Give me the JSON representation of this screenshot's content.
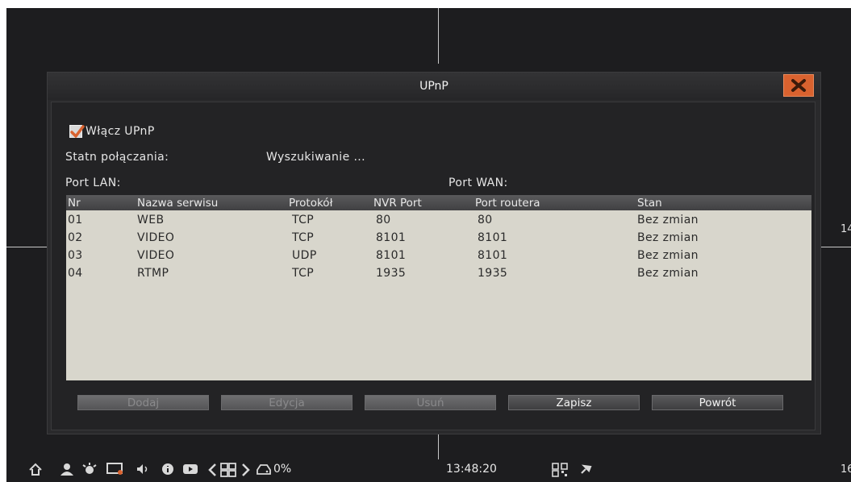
{
  "dialog": {
    "title": "UPnP",
    "close_icon": "close-x-icon"
  },
  "upnp": {
    "enable_label": "Włącz UPnP",
    "enabled": true,
    "status_label": "Statn połączania:",
    "status_value": "Wyszukiwanie ...",
    "port_lan_label": "Port LAN:",
    "port_wan_label": "Port WAN:"
  },
  "table": {
    "headers": [
      "Nr",
      "Nazwa serwisu",
      "Protokół",
      "NVR Port",
      "Port routera",
      "Stan"
    ],
    "rows": [
      [
        "01",
        "WEB",
        "TCP",
        "80",
        "80",
        "Bez zmian"
      ],
      [
        "02",
        "VIDEO",
        "TCP",
        "8101",
        "8101",
        "Bez zmian"
      ],
      [
        "03",
        "VIDEO",
        "UDP",
        "8101",
        "8101",
        "Bez zmian"
      ],
      [
        "04",
        "RTMP",
        "TCP",
        "1935",
        "1935",
        "Bez zmian"
      ]
    ]
  },
  "buttons": {
    "add": "Dodaj",
    "edit": "Edycja",
    "delete": "Usuń",
    "save": "Zapisz",
    "back": "Powrót"
  },
  "channels": {
    "ch_a": "14",
    "ch_b": "16"
  },
  "taskbar": {
    "hdd_usage": "0%",
    "clock": "13:48:20",
    "icons": [
      "home-icon",
      "user-icon",
      "alarm-icon",
      "monitor-icon",
      "volume-icon",
      "info-icon",
      "playback-icon",
      "prev-icon",
      "layout-grid-icon",
      "next-icon",
      "hdd-icon",
      "qr-code-icon",
      "pin-icon"
    ]
  },
  "colors": {
    "close_button": "#d9622f",
    "checkbox_check": "#d9622f",
    "table_background": "#d8d6cc"
  }
}
